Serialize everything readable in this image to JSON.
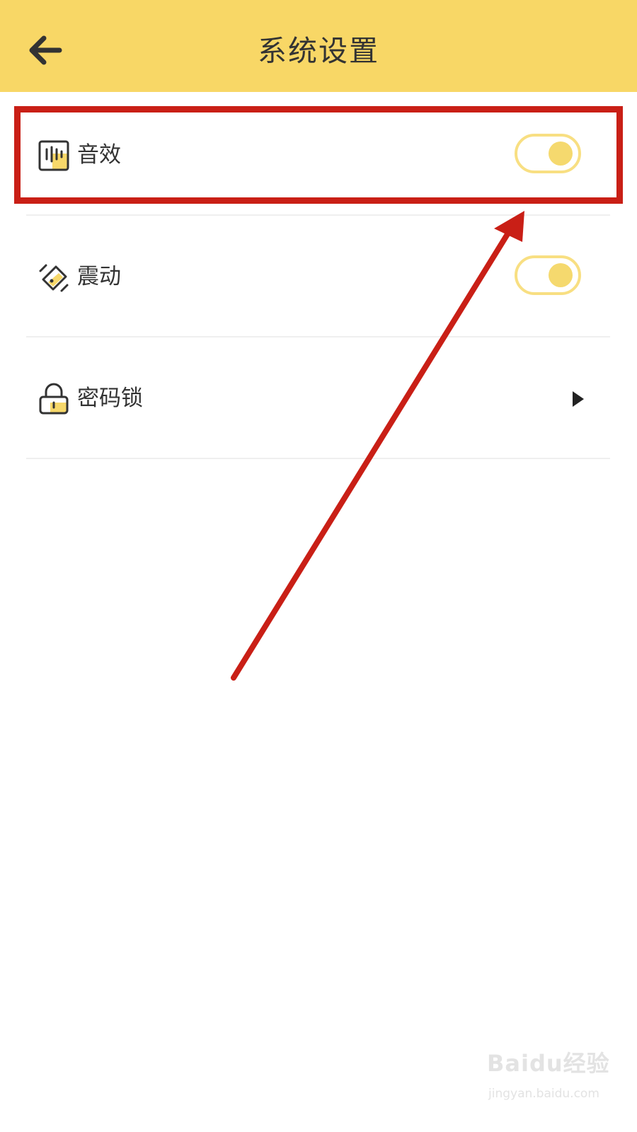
{
  "header": {
    "title": "系统设置",
    "back_icon": "arrow-left-icon",
    "background": "#F8D766"
  },
  "settings": [
    {
      "label": "音效",
      "icon": "sound-effects-icon",
      "control": "toggle",
      "enabled": true
    },
    {
      "label": "震动",
      "icon": "vibration-icon",
      "control": "toggle",
      "enabled": true
    },
    {
      "label": "密码锁",
      "icon": "lock-icon",
      "control": "chevron",
      "chevron_icon": "chevron-right-icon"
    }
  ],
  "annotation": {
    "color": "#C91F16",
    "target": "音效"
  },
  "watermark": {
    "logo": "Baidu经验",
    "url": "jingyan.baidu.com"
  }
}
